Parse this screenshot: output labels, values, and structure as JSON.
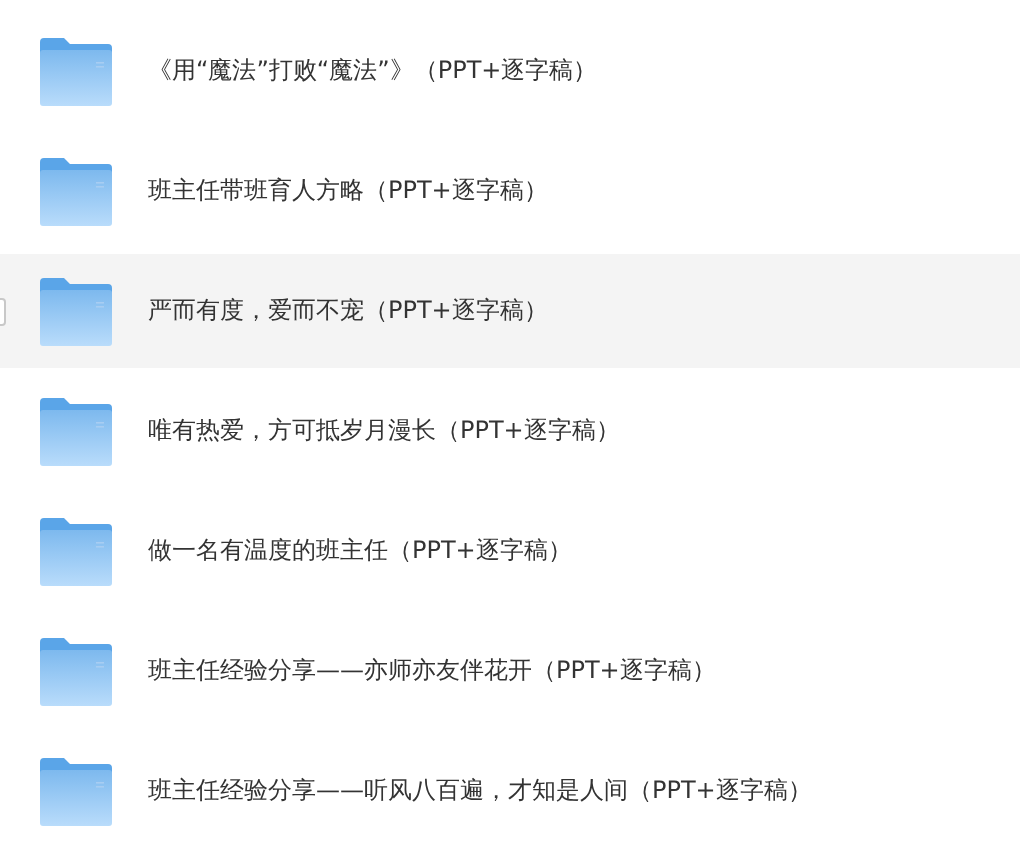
{
  "folders": [
    {
      "name": "《用“魔法”打败“魔法”》（PPT+逐字稿）",
      "hovered": false
    },
    {
      "name": "班主任带班育人方略（PPT+逐字稿）",
      "hovered": false
    },
    {
      "name": "严而有度，爱而不宠（PPT+逐字稿）",
      "hovered": true
    },
    {
      "name": "唯有热爱，方可抵岁月漫长（PPT+逐字稿）",
      "hovered": false
    },
    {
      "name": "做一名有温度的班主任（PPT+逐字稿）",
      "hovered": false
    },
    {
      "name": "班主任经验分享——亦师亦友伴花开（PPT+逐字稿）",
      "hovered": false
    },
    {
      "name": "班主任经验分享——听风八百遍，才知是人间（PPT+逐字稿）",
      "hovered": false
    }
  ]
}
